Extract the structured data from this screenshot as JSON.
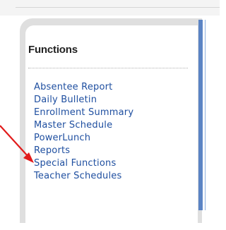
{
  "functions_panel": {
    "title": "Functions",
    "links": [
      "Absentee Report",
      "Daily Bulletin",
      "Enrollment Summary",
      "Master Schedule",
      "PowerLunch",
      "Reports",
      "Special Functions",
      "Teacher Schedules"
    ]
  },
  "annotation": {
    "arrow_color": "#e11b1b",
    "target": "Reports"
  },
  "colors": {
    "link": "#1f4fa0",
    "accent_bar": "#5b84c4"
  }
}
